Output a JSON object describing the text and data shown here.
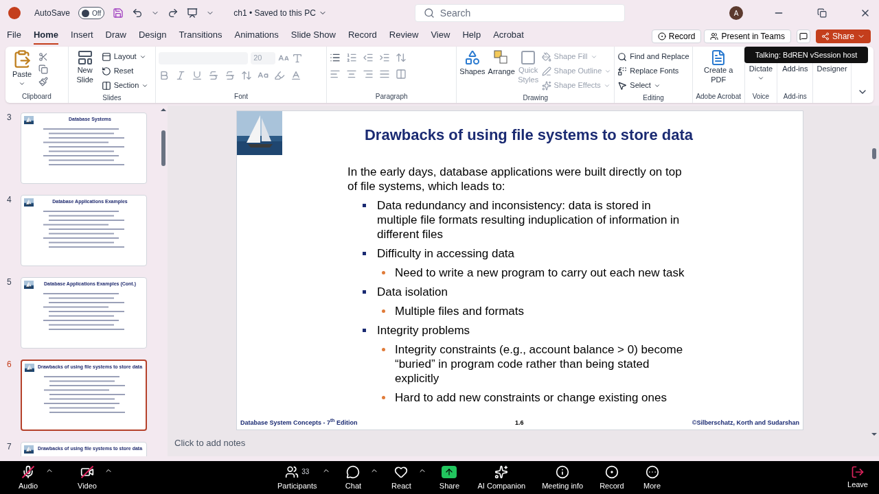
{
  "title_bar": {
    "autosave_label": "AutoSave",
    "autosave": {
      "on": false,
      "label": "Off"
    },
    "document_title": "ch1 • Saved to this PC",
    "search_placeholder": "Search",
    "avatar": "A"
  },
  "menu_tabs": [
    {
      "label": "File",
      "selected": false
    },
    {
      "label": "Home",
      "selected": true
    },
    {
      "label": "Insert",
      "selected": false
    },
    {
      "label": "Draw",
      "selected": false
    },
    {
      "label": "Design",
      "selected": false
    },
    {
      "label": "Transitions",
      "selected": false
    },
    {
      "label": "Animations",
      "selected": false
    },
    {
      "label": "Slide Show",
      "selected": false
    },
    {
      "label": "Record",
      "selected": false
    },
    {
      "label": "Review",
      "selected": false
    },
    {
      "label": "View",
      "selected": false
    },
    {
      "label": "Help",
      "selected": false
    },
    {
      "label": "Acrobat",
      "selected": false
    }
  ],
  "top_actions": {
    "record": "Record",
    "present": "Present in Teams",
    "share": "Share"
  },
  "ribbon": {
    "clipboard": {
      "label": "Clipboard",
      "paste": "Paste"
    },
    "slides": {
      "label": "Slides",
      "new_slide": "New Slide",
      "layout": "Layout",
      "reset": "Reset",
      "section": "Section"
    },
    "font": {
      "label": "Font",
      "size": "20",
      "disabled": true
    },
    "paragraph": {
      "label": "Paragraph"
    },
    "drawing": {
      "label": "Drawing",
      "shapes": "Shapes",
      "arrange": "Arrange",
      "quick_styles": {
        "label": "Quick Styles",
        "disabled": true
      },
      "shape_fill": {
        "label": "Shape Fill",
        "disabled": true
      },
      "shape_outline": {
        "label": "Shape Outline",
        "disabled": true
      },
      "shape_effects": {
        "label": "Shape Effects",
        "disabled": true
      }
    },
    "editing": {
      "label": "Editing",
      "find_replace": "Find and Replace",
      "replace_fonts": "Replace Fonts",
      "select": "Select"
    },
    "acrobat": {
      "label": "Adobe Acrobat",
      "create_pdf": "Create a PDF"
    },
    "voice": {
      "label": "Voice",
      "dictate": "Dictate"
    },
    "addins": {
      "label": "Add-ins",
      "button": "Add-ins"
    },
    "designer": {
      "button": "Designer"
    }
  },
  "tooltip": "Talking: BdREN vSession host",
  "thumbnails": [
    {
      "number": "3",
      "title": "Database Systems",
      "selected": false
    },
    {
      "number": "4",
      "title": "Database Applications Examples",
      "selected": false
    },
    {
      "number": "5",
      "title": "Database Applications Examples (Cont.)",
      "selected": false
    },
    {
      "number": "6",
      "title": "Drawbacks of using file systems to store data",
      "selected": true
    },
    {
      "number": "7",
      "title": "Drawbacks of using file systems to store data",
      "selected": false
    }
  ],
  "slide": {
    "title": "Drawbacks of using file systems to store data",
    "intro": "In the early days, database applications were built directly on top of file systems, which leads to:",
    "bullets": [
      {
        "text": "Data redundancy and inconsistency: data is stored  in multiple file formats resulting induplication of information in different files"
      },
      {
        "text": "Difficulty in accessing data",
        "children": [
          {
            "text": "Need to write a new program to carry out each new task"
          }
        ]
      },
      {
        "text": "Data isolation",
        "children": [
          {
            "text": "Multiple files and formats"
          }
        ]
      },
      {
        "text": "Integrity problems",
        "children": [
          {
            "text": "Integrity constraints  (e.g., account balance > 0) become “buried” in program code rather than being stated explicitly"
          },
          {
            "text": "Hard to add new constraints or change existing ones"
          }
        ]
      }
    ],
    "footer_left": "Database System Concepts - 7$^{th}$ Edition",
    "footer_center": "1.6",
    "footer_right": "©Silberschatz, Korth and Sudarshan"
  },
  "notes_placeholder": "Click to add notes",
  "meeting_toolbar": {
    "left": [
      {
        "kind": "audio",
        "label": "Audio",
        "off": true,
        "menu": true
      },
      {
        "kind": "video",
        "label": "Video",
        "off": true,
        "menu": true
      }
    ],
    "center": [
      {
        "kind": "participants",
        "label": "Participants",
        "count": "33",
        "menu": true
      },
      {
        "kind": "chat",
        "label": "Chat",
        "menu": true
      },
      {
        "kind": "react",
        "label": "React",
        "menu": true
      },
      {
        "kind": "share",
        "label": "Share",
        "menu": false
      },
      {
        "kind": "ai",
        "label": "AI Companion",
        "menu": false
      },
      {
        "kind": "info",
        "label": "Meeting info",
        "menu": false
      },
      {
        "kind": "record",
        "label": "Record",
        "menu": false
      },
      {
        "kind": "more",
        "label": "More",
        "menu": false
      }
    ],
    "leave": "Leave"
  }
}
